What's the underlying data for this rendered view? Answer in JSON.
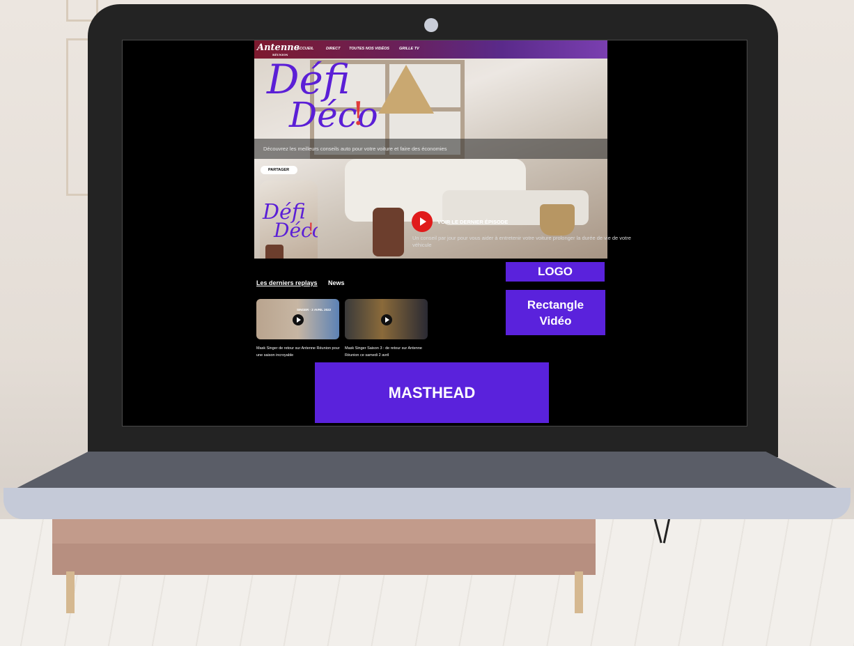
{
  "site": {
    "logo": "Antenne",
    "logo_sub": "RÉUNION",
    "nav": [
      "ACCUEIL",
      "DIRECT",
      "TOUTES NOS VIDÉOS",
      "GRILLE TV"
    ]
  },
  "hero": {
    "title_line1": "Défi",
    "title_line2": "Déco",
    "title_mark": "!",
    "tagline": "Découvrez les meilleurs conseils auto pour votre voiture et faire des économies",
    "share_label": "PARTAGER",
    "cta_label": "VOIR LE DERNIER ÉPISODE",
    "description": "Un conseil par jour pour vous aider à entretenir votre voiture prolonger la durée de vie de votre véhicule"
  },
  "tabs": [
    {
      "label": "Les derniers replays",
      "active": true
    },
    {
      "label": "News",
      "active": false
    }
  ],
  "replays": [
    {
      "overlay": "SINGER · 2 AVRIL 2022",
      "caption": "Mask Singer de retour sur Antenne Réunion pour une saison incroyable"
    },
    {
      "overlay": "",
      "caption": "Mask Singer Saison 3 : de retour sur Antenne Réunion ce samedi 2 avril"
    }
  ],
  "ads": {
    "logo": "LOGO",
    "rectangle_line1": "Rectangle",
    "rectangle_line2": "Vidéo",
    "masthead": "MASTHEAD"
  },
  "colors": {
    "ad_purple": "#5a22dc",
    "title_purple": "#5b1fd6",
    "play_red": "#e01b1b",
    "laptop_frame": "#232323"
  }
}
